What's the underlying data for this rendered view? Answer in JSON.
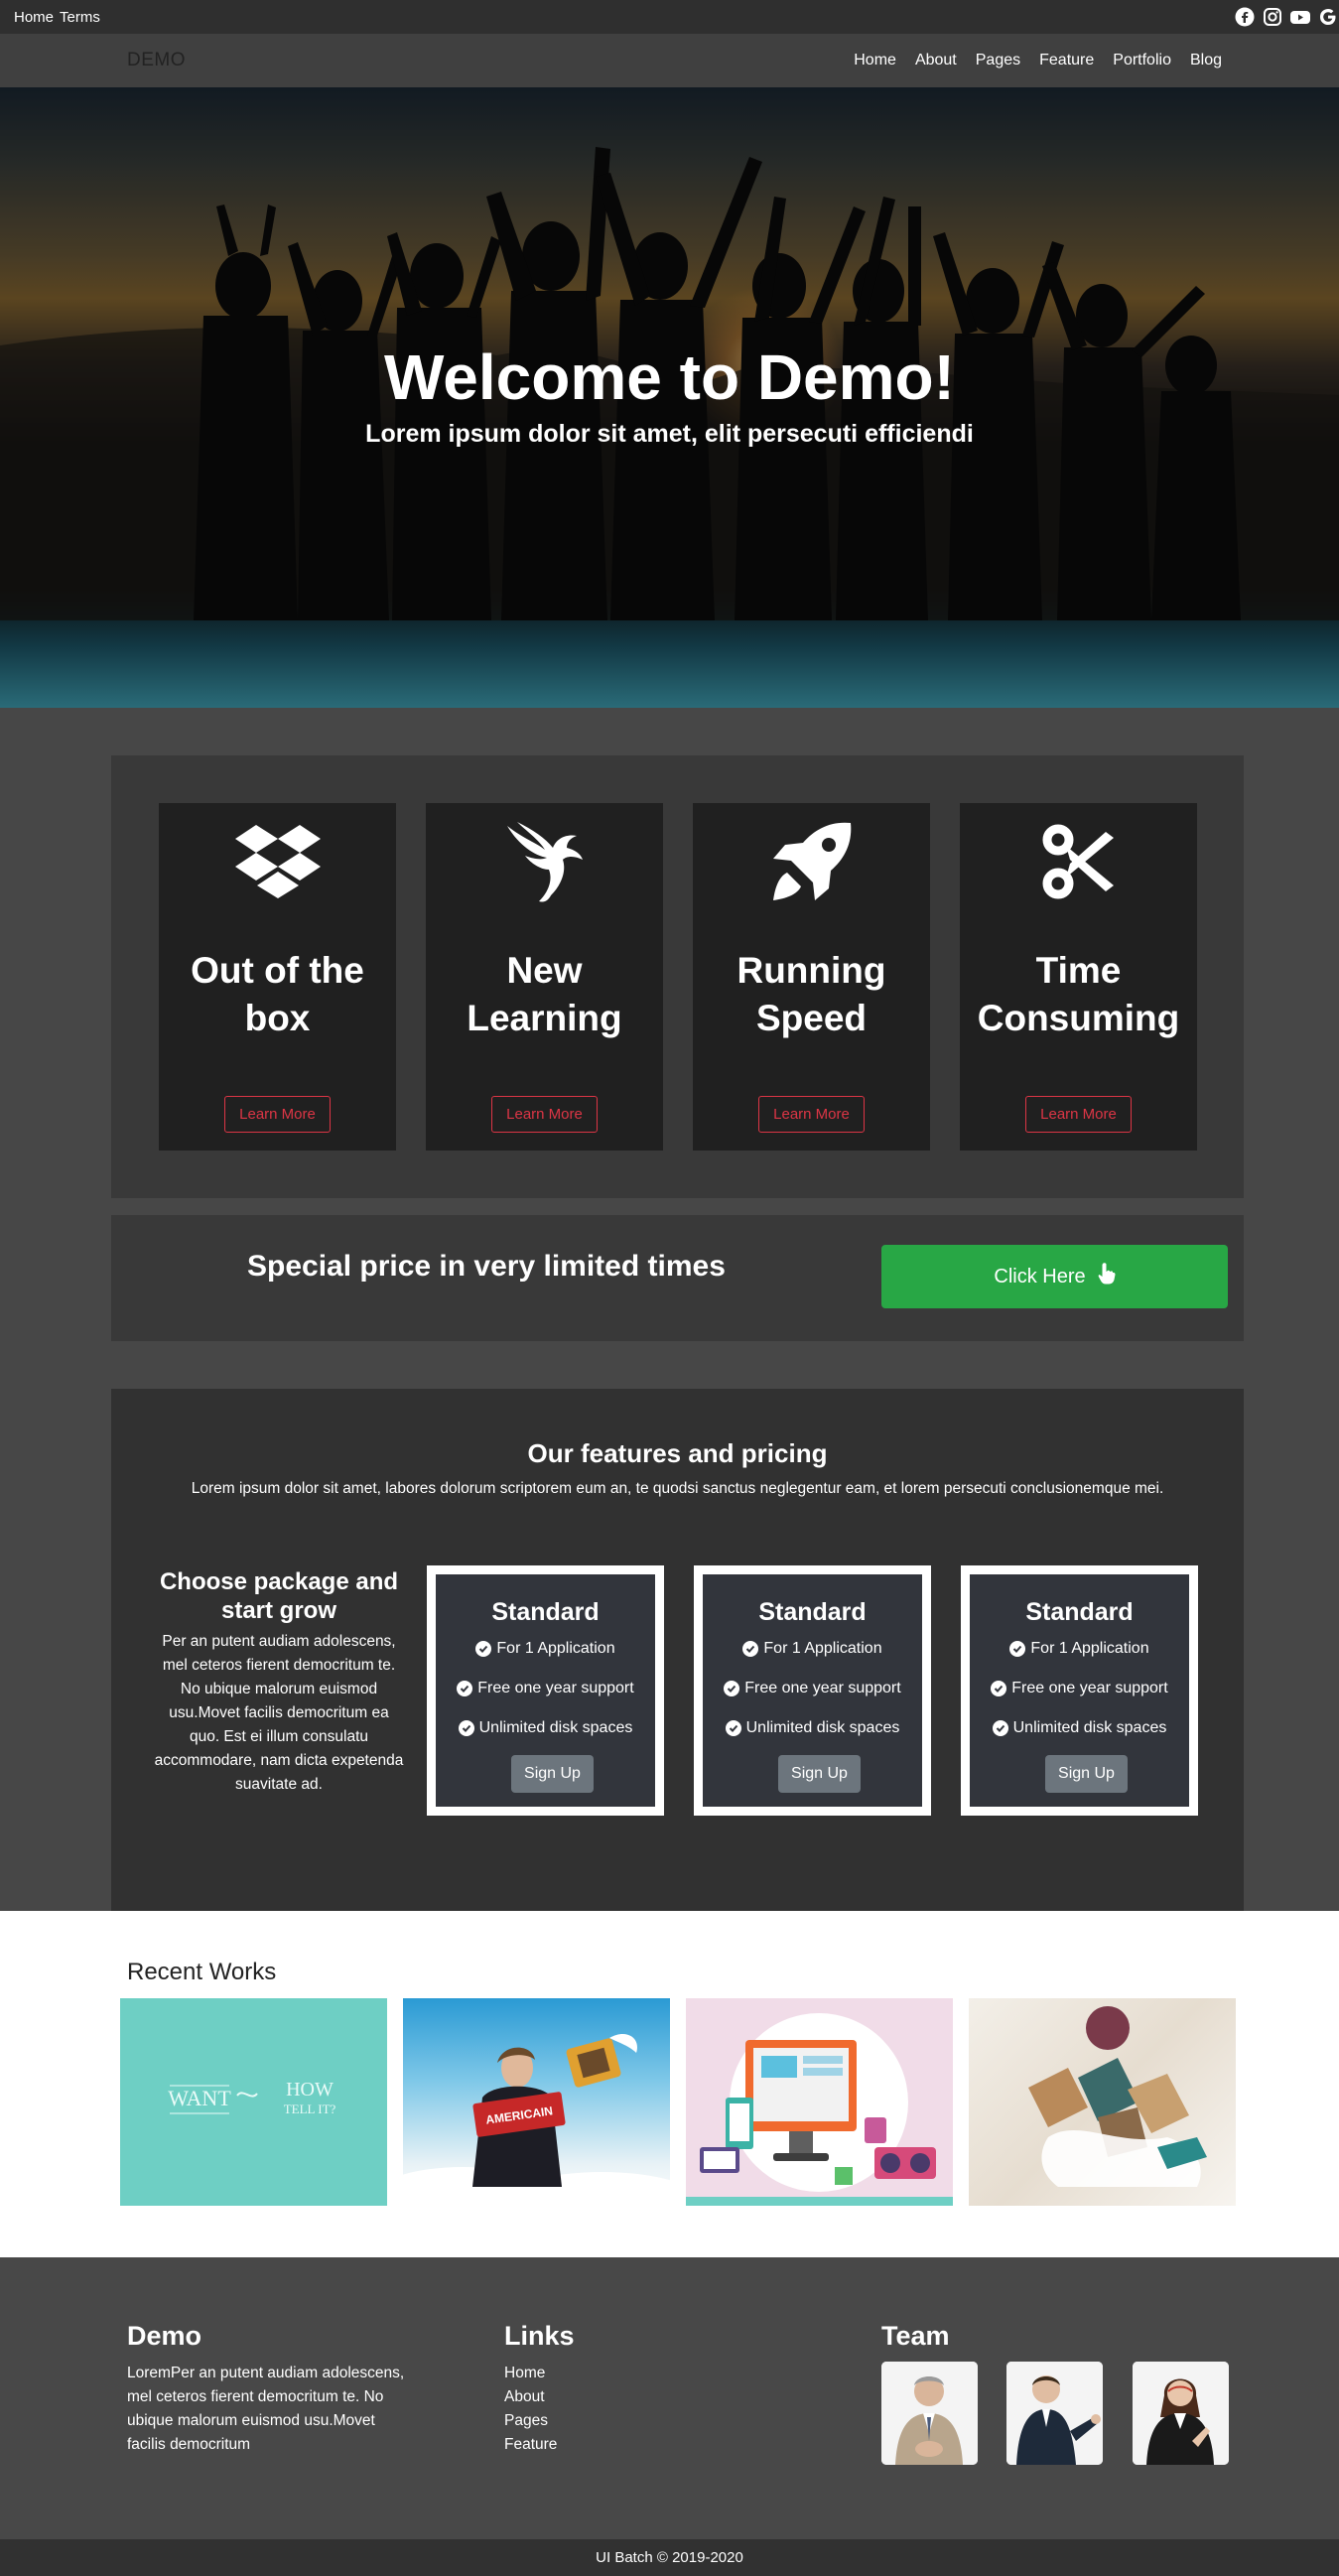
{
  "topbar": {
    "links": [
      "Home",
      "Terms"
    ],
    "social_icons": [
      "facebook-icon",
      "instagram-icon",
      "youtube-icon",
      "google-icon"
    ]
  },
  "nav": {
    "brand": "DEMO",
    "items": [
      "Home",
      "About",
      "Pages",
      "Feature",
      "Portfolio",
      "Blog"
    ]
  },
  "hero": {
    "title": "Welcome to Demo!",
    "subtitle": "Lorem ipsum dolor sit amet, elit persecuti efficiendi"
  },
  "services": [
    {
      "icon": "dropbox-icon",
      "title_line1": "Out of the",
      "title_line2": "box",
      "button": "Learn More"
    },
    {
      "icon": "phoenix-icon",
      "title_line1": "New",
      "title_line2": "Learning",
      "button": "Learn More"
    },
    {
      "icon": "rocket-icon",
      "title_line1": "Running",
      "title_line2": "Speed",
      "button": "Learn More"
    },
    {
      "icon": "scissors-icon",
      "title_line1": "Time",
      "title_line2": "Consuming",
      "button": "Learn More"
    }
  ],
  "cta": {
    "text": "Special price in very limited times",
    "button": "Click Here",
    "button_icon": "hand-pointer-icon",
    "button_color": "#28a745"
  },
  "pricing": {
    "title": "Our features and pricing",
    "subtitle": "Lorem ipsum dolor sit amet, labores dolorum scriptorem eum an, te quodsi sanctus neglegentur eam, et lorem persecuti conclusionemque mei.",
    "left_heading_line1": "Choose package and",
    "left_heading_line2": "start grow",
    "left_text": "Per an putent audiam adolescens, mel ceteros fierent democritum te. No ubique malorum euismod usu.Movet facilis democritum ea quo. Est ei illum consulatu accommodare, nam dicta expetenda suavitate ad.",
    "plans": [
      {
        "name": "Standard",
        "features": [
          "For 1 Application",
          "Free one year support",
          "Unlimited disk spaces"
        ],
        "button": "Sign Up"
      },
      {
        "name": "Standard",
        "features": [
          "For 1 Application",
          "Free one year support",
          "Unlimited disk spaces"
        ],
        "button": "Sign Up"
      },
      {
        "name": "Standard",
        "features": [
          "For 1 Application",
          "Free one year support",
          "Unlimited disk spaces"
        ],
        "button": "Sign Up"
      }
    ]
  },
  "works": {
    "title": "Recent Works",
    "thumb1_text": {
      "a": "WANT",
      "b": "HOW",
      "c": "TELL IT?"
    },
    "thumb2_text": "AMERICAIN"
  },
  "footer": {
    "about_title": "Demo",
    "about_text": "LoremPer an putent audiam adolescens, mel ceteros fierent democritum te. No ubique malorum euismod usu.Movet facilis democritum",
    "links_title": "Links",
    "links": [
      "Home",
      "About",
      "Pages",
      "Feature"
    ],
    "team_title": "Team",
    "copyright": "UI Batch © 2019-2020"
  }
}
